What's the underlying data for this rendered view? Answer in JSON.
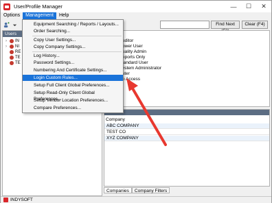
{
  "window": {
    "title": "User/Profile Manager",
    "controls": {
      "minimize": "—",
      "maximize": "☐",
      "close": "✕"
    }
  },
  "menubar": {
    "items": [
      {
        "label": "Options"
      },
      {
        "label": "Management"
      },
      {
        "label": "Help"
      }
    ]
  },
  "toolbar": {
    "search_value": "",
    "find_next": "Find Next (F3)",
    "clear": "Clear (F4)"
  },
  "users_panel": {
    "header": "Users",
    "tree": [
      {
        "label": "IN"
      },
      {
        "label": "NI"
      },
      {
        "label": "RE"
      },
      {
        "label": "TE"
      },
      {
        "label": "TE"
      }
    ]
  },
  "roles_panel": {
    "items": [
      {
        "label": "uditor"
      },
      {
        "label": "ower User"
      },
      {
        "label": "uality Admin"
      },
      {
        "label": "eports Only"
      },
      {
        "label": "tandard User"
      },
      {
        "label": "ystem Administrator"
      },
      {
        "label": "ster"
      },
      {
        "label": "o Access"
      }
    ]
  },
  "company_panel": {
    "column_header": "Company",
    "rows": [
      {
        "name": "ABC COMPANY"
      },
      {
        "name": "TEST CO"
      },
      {
        "name": "XYZ COMPANY"
      }
    ],
    "tabs": [
      {
        "label": "Companies"
      },
      {
        "label": "Company Filters"
      }
    ]
  },
  "statusbar": {
    "text": "INDYSOFT"
  },
  "management_menu": {
    "items": [
      {
        "label": "Equipment Searching / Reports / Layouts..."
      },
      {
        "label": "Order Searching..."
      },
      {
        "label": "Copy User Settings..."
      },
      {
        "label": "Copy Company Settings..."
      },
      {
        "label": "Log History..."
      },
      {
        "label": "Password Settings..."
      },
      {
        "label": "Numbering And Certificate Settings..."
      },
      {
        "label": "Login Custom Rules..."
      },
      {
        "label": "Setup Full Client Global Preferences..."
      },
      {
        "label": "Setup Read-Only Client Global Preferences..."
      },
      {
        "label": "Setup Vendor Location Preferences..."
      },
      {
        "label": "Compare Preferences..."
      }
    ]
  },
  "colors": {
    "highlight": "#1a73d9",
    "arrow": "#e8382f",
    "panel_header": "#5c6d83"
  }
}
